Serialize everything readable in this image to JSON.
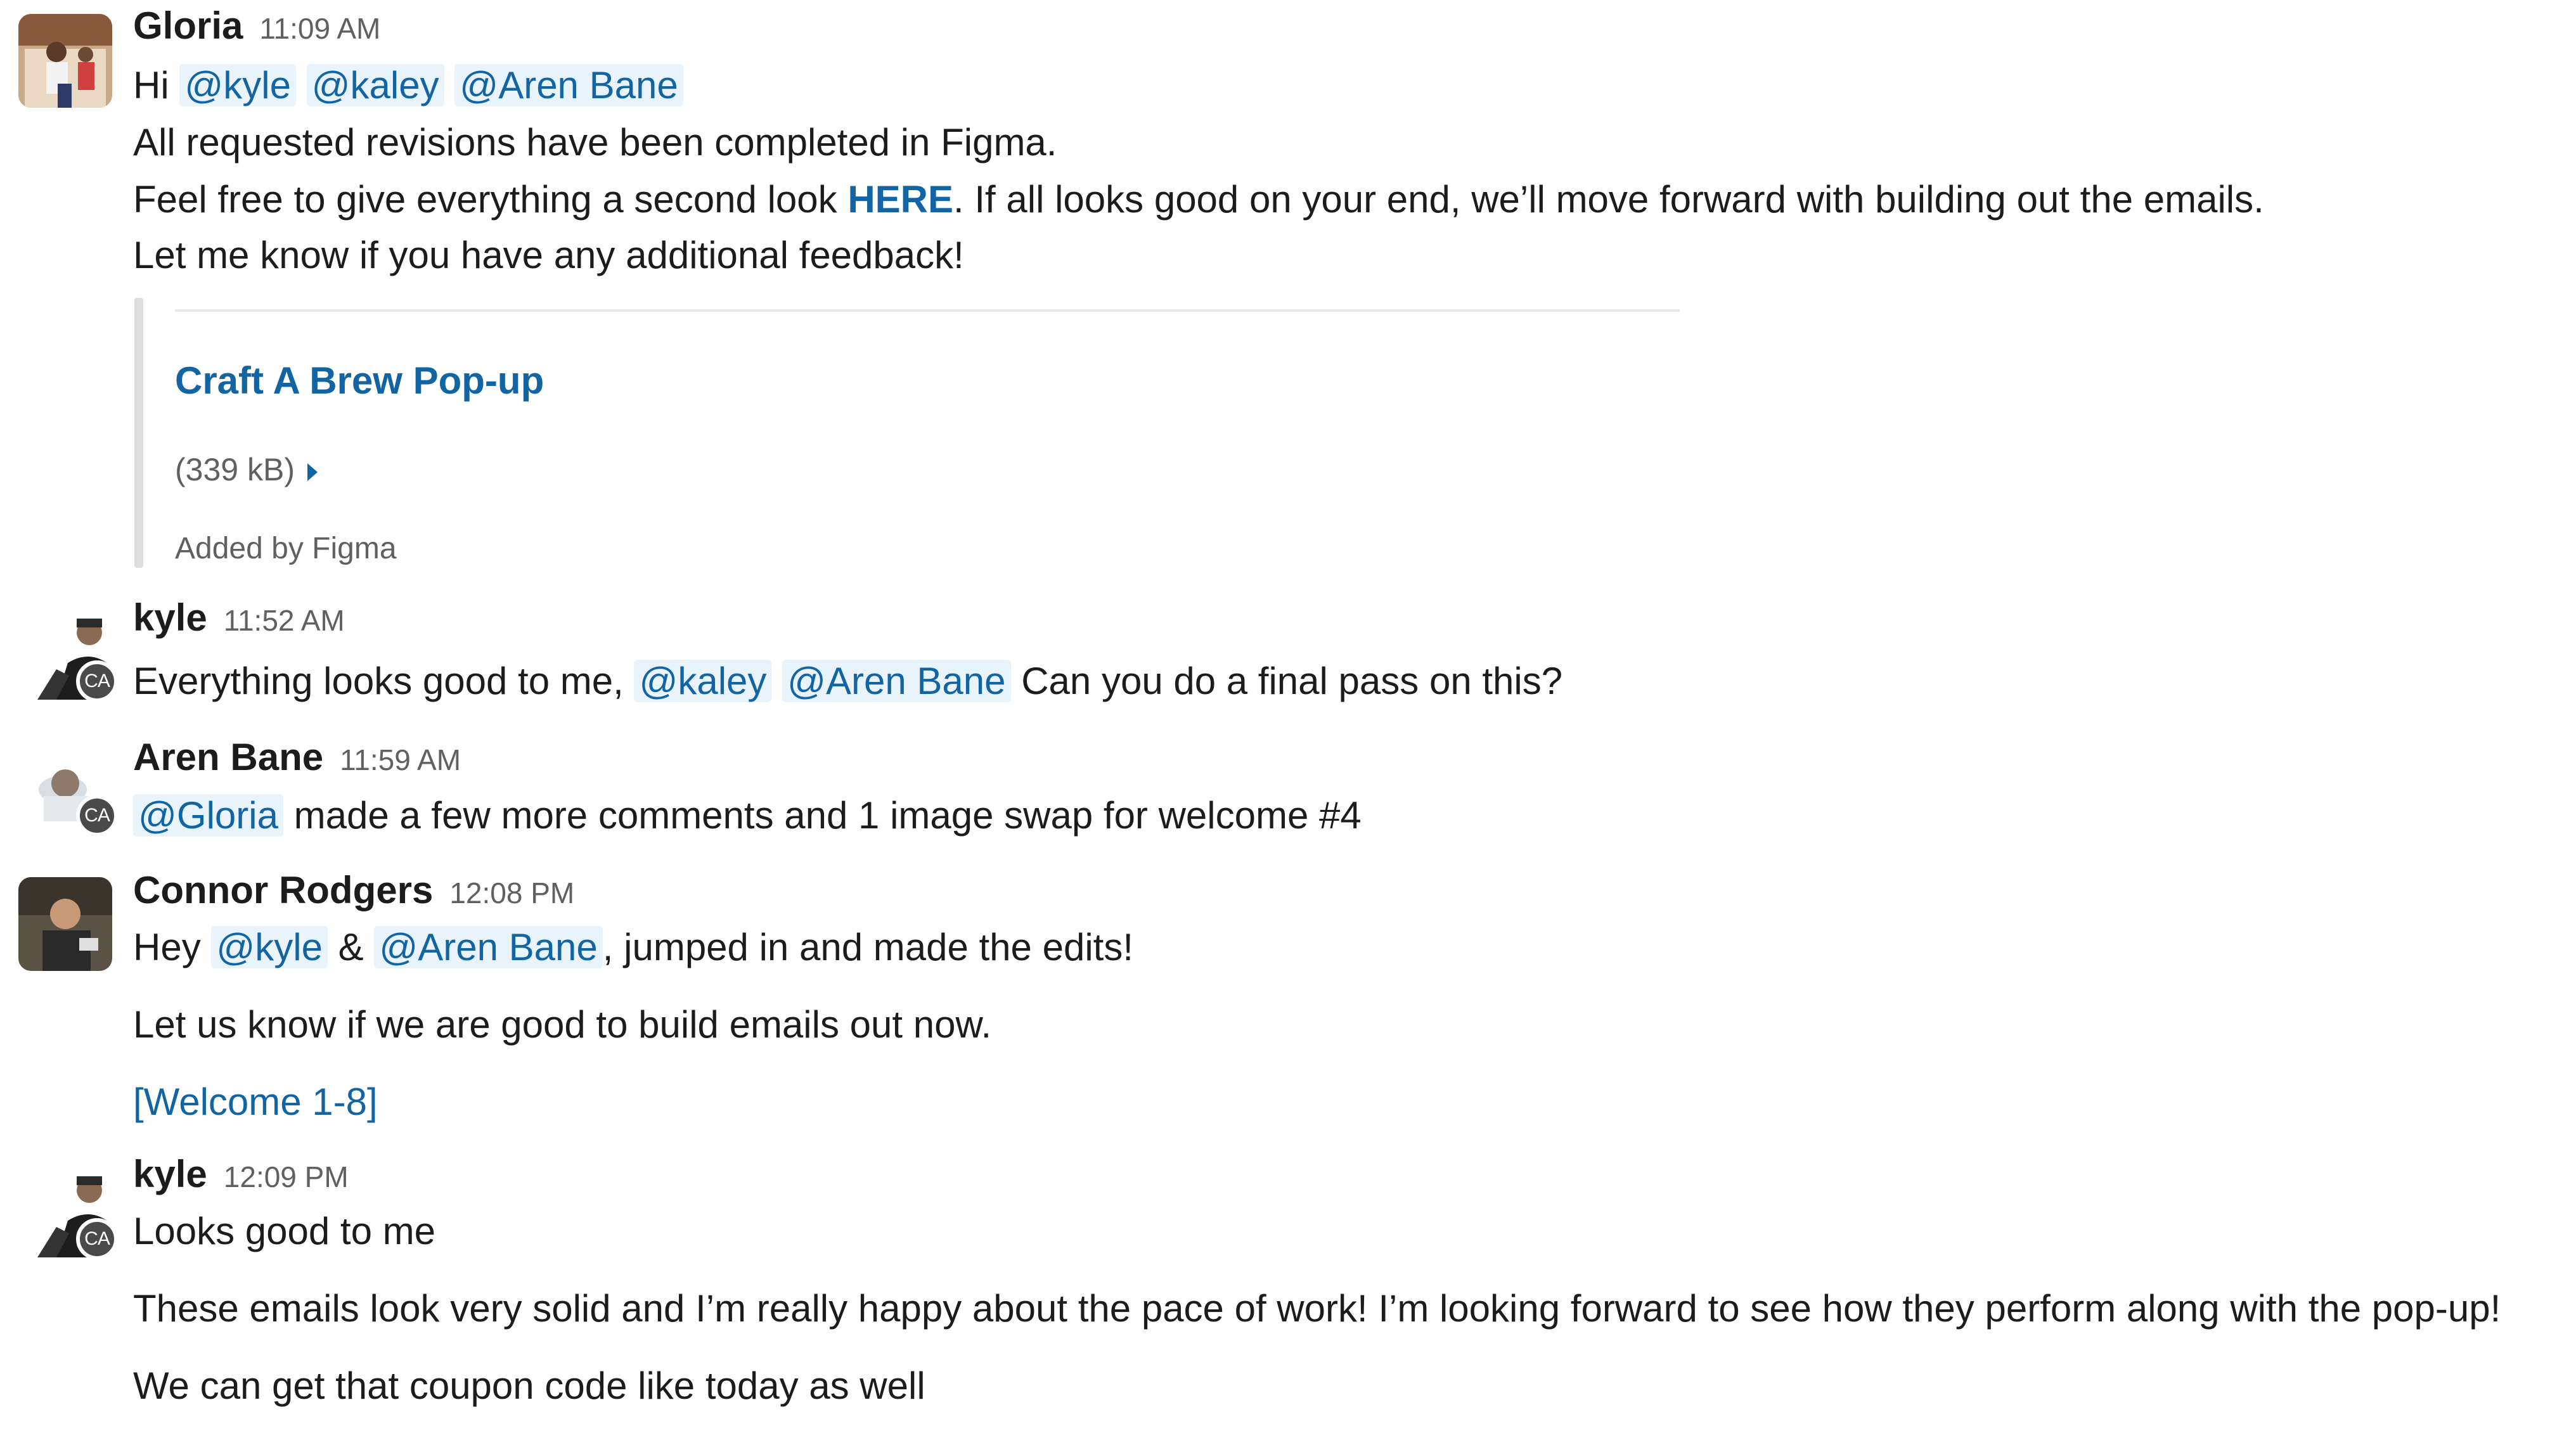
{
  "messages": [
    {
      "author": "Gloria",
      "time": "11:09 AM",
      "avatar_icon": "person-photo-avatar",
      "line1": {
        "prefix": "Hi ",
        "mentions": [
          "@kyle",
          "@kaley",
          "@Aren Bane"
        ]
      },
      "line2": "All requested revisions have been completed in Figma.",
      "line3": {
        "before": "Feel free to give everything a second look ",
        "link": "HERE",
        "after": ". If all looks good on your end, we’ll move forward with building out the emails."
      },
      "line4": "Let me know if you have any additional feedback!",
      "attachment": {
        "title": "Craft A Brew Pop-up",
        "size": "(339 kB)",
        "source": "Added by Figma",
        "expand_icon": "caret-right-icon"
      }
    },
    {
      "author": "kyle",
      "time": "11:52 AM",
      "badge": "CA",
      "before": "Everything looks good to me, ",
      "mentions": [
        "@kaley",
        "@Aren Bane"
      ],
      "after": " Can you do a final pass on this?"
    },
    {
      "author": "Aren Bane",
      "time": "11:59 AM",
      "badge": "CA",
      "mention": "@Gloria",
      "after": " made a few more comments and 1 image swap for welcome #4"
    },
    {
      "author": "Connor Rodgers",
      "time": "12:08 PM",
      "line1": {
        "prefix": "Hey ",
        "mention1": "@kyle",
        "amp": " & ",
        "mention2": "@Aren Bane",
        "after": ", jumped in and made the edits!"
      },
      "line2": "Let us know if we are good to build emails out now.",
      "link": "[Welcome 1-8]"
    },
    {
      "author": "kyle",
      "time": "12:09 PM",
      "badge": "CA",
      "line1": "Looks good to me",
      "line2": "These emails look very solid and I’m really happy about the pace of work! I’m looking forward to see how they perform along with the pop-up!",
      "line3": "We can get that coupon code like today as well"
    }
  ],
  "colors": {
    "link": "#1264a3",
    "mention_bg": "#e8f3fc",
    "muted": "#616061"
  }
}
